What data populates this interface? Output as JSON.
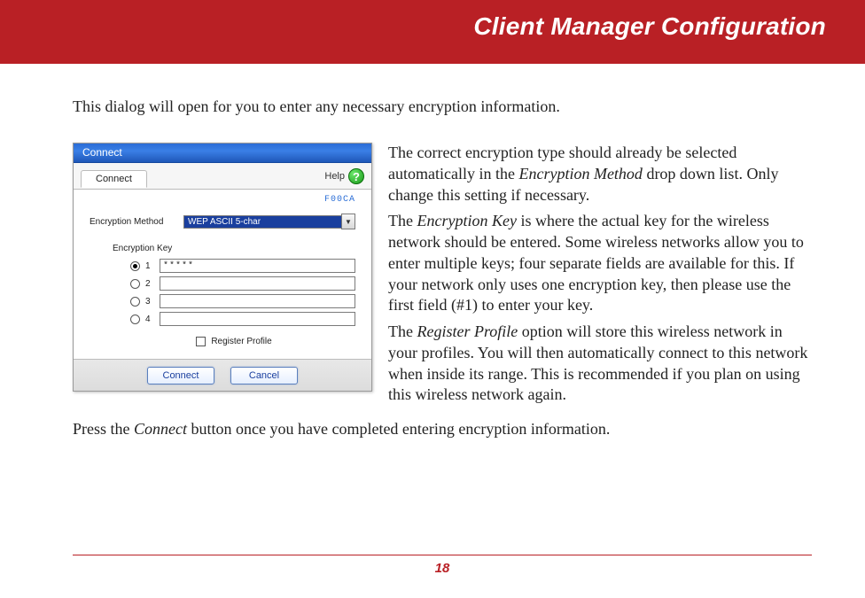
{
  "header": {
    "title": "Client Manager Configuration"
  },
  "intro": "This dialog will open for you to enter any necessary encryption information.",
  "dialog": {
    "window_title": "Connect",
    "tab_label": "Connect",
    "help_label": "Help",
    "network_name": "F00CA",
    "method_label": "Encryption Method",
    "method_value": "WEP ASCII 5-char",
    "keys_label": "Encryption Key",
    "keys": [
      {
        "num": "1",
        "value": "*****",
        "checked": true
      },
      {
        "num": "2",
        "value": "",
        "checked": false
      },
      {
        "num": "3",
        "value": "",
        "checked": false
      },
      {
        "num": "4",
        "value": "",
        "checked": false
      }
    ],
    "register_label": "Register Profile",
    "connect_btn": "Connect",
    "cancel_btn": "Cancel"
  },
  "paras": {
    "p1a": "The correct encryption type should already be selected automatically in the ",
    "p1i": "Encryption Method",
    "p1b": " drop down list.  Only change this setting if necessary.",
    "p2a": "The ",
    "p2i": "Encryption Key",
    "p2b": " is where the actual key for the wireless network should be entered.  Some wireless networks allow you to enter multiple keys; four separate fields are available for this.  If your network only uses one encryption key, then please use the first field (#1) to enter your key.",
    "p3a": "The ",
    "p3i": "Register Profile",
    "p3b": " option will store this wireless network in your profiles.  You will then automatically connect to this network when inside its range.  This is recommended if you plan on using this wireless network again."
  },
  "outro_a": "Press the ",
  "outro_i": "Connect",
  "outro_b": " button once you have completed entering encryption information.",
  "page_number": "18"
}
